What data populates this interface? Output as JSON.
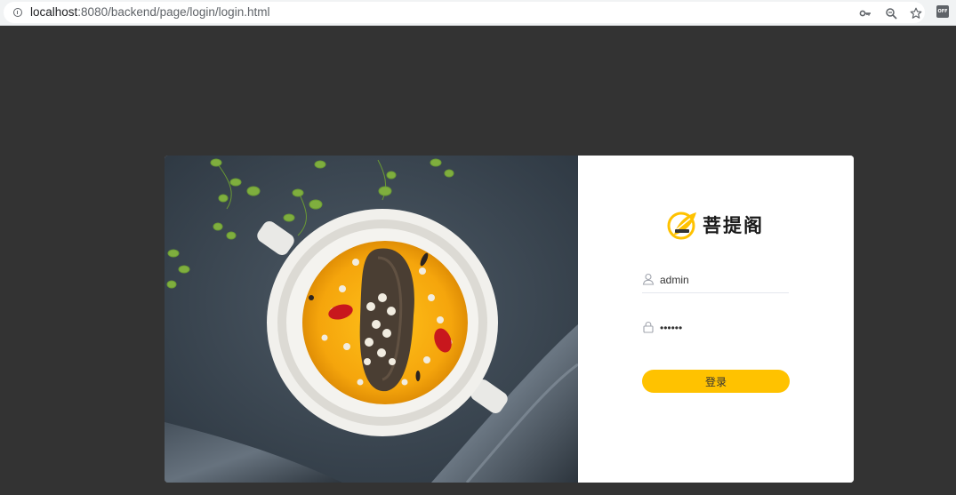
{
  "browser": {
    "url_host": "localhost",
    "url_rest": ":8080/backend/page/login/login.html",
    "extension_label": "OFF"
  },
  "brand": {
    "name": "菩提阁",
    "accent_color": "#ffc200"
  },
  "login": {
    "username_value": "admin",
    "password_value": "123456",
    "submit_label": "登录"
  },
  "colors": {
    "page_background": "#333333",
    "button": "#ffc200",
    "panel": "#ffffff"
  }
}
